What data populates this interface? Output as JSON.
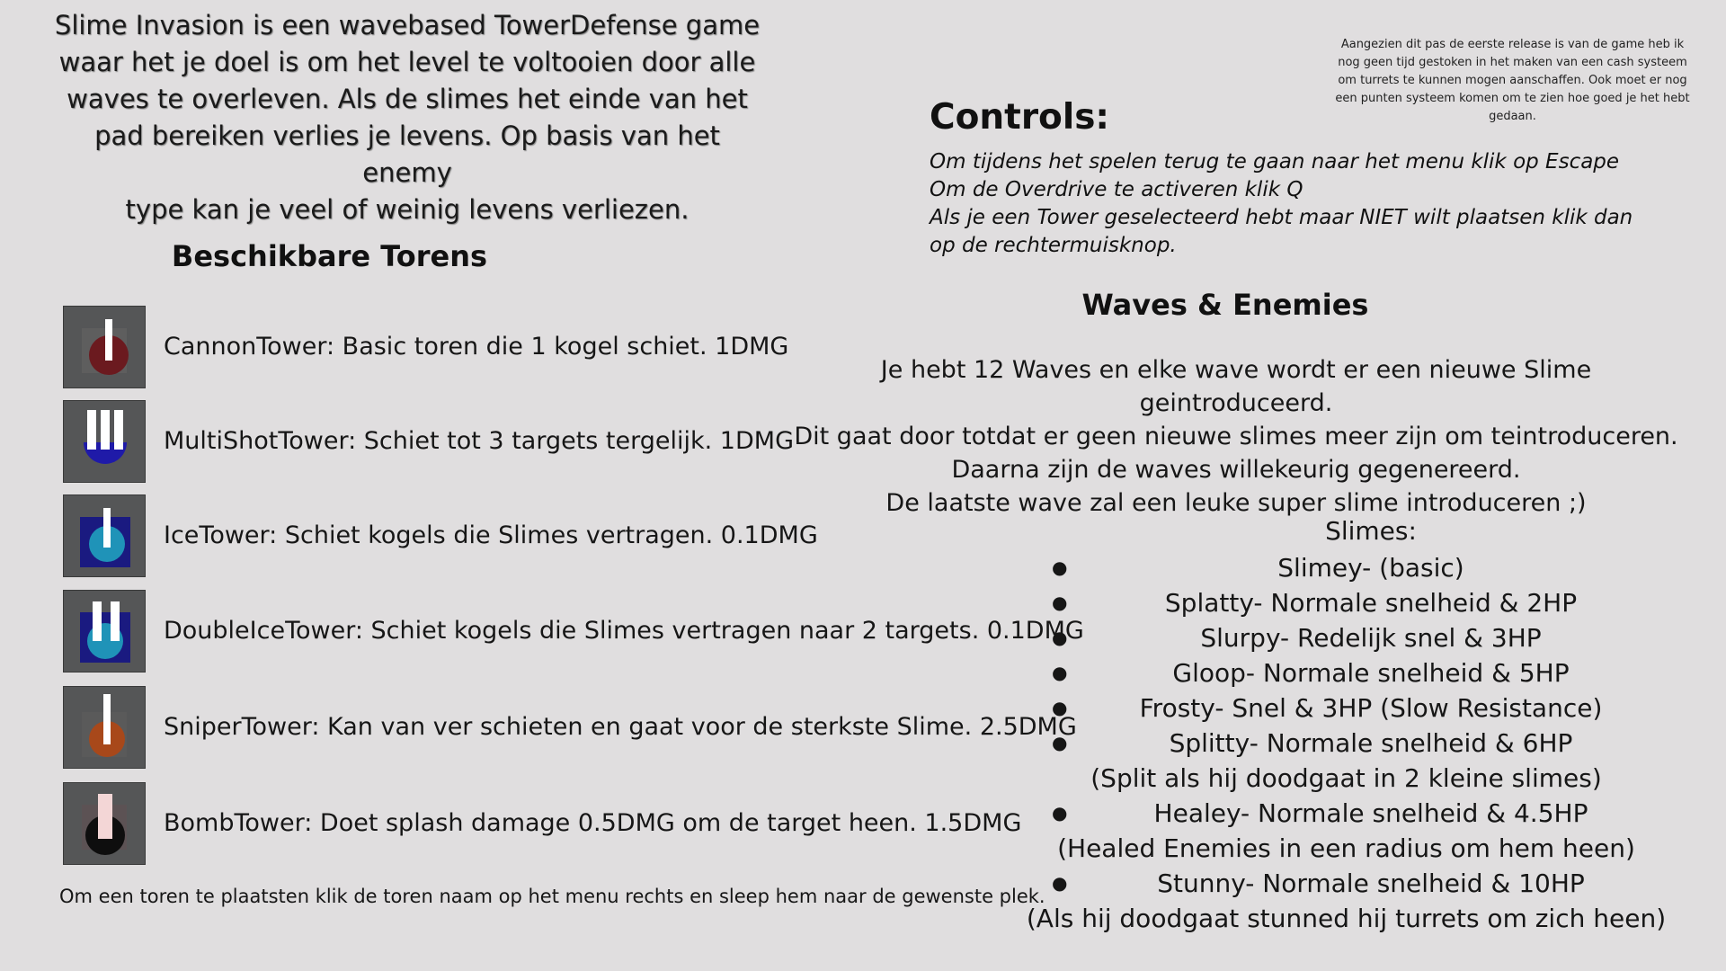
{
  "intro": {
    "lines": [
      "Slime Invasion is een wavebased TowerDefense game",
      "waar het je doel is om het level te voltooien door alle",
      "waves te overleven. Als de slimes het einde van het",
      "pad bereiken verlies je levens. Op basis van het enemy",
      "type kan je veel of weinig levens verliezen."
    ]
  },
  "note": "Aangezien dit pas de eerste release is van de game heb ik nog geen tijd gestoken in het maken van een cash systeem om turrets te kunnen mogen aanschaffen. Ook moet er nog een punten systeem komen om te zien hoe goed je het hebt gedaan.",
  "controls": {
    "title": "Controls:",
    "items": [
      "Om tijdens het spelen terug te gaan naar het menu klik op Escape",
      "Om de Overdrive te activeren klik Q",
      "Als je een Tower geselecteerd hebt maar NIET wilt plaatsen klik dan op de rechtermuisknop."
    ]
  },
  "towers": {
    "title": "Beschikbare Torens",
    "items": [
      {
        "label": "CannonTower: Basic toren die 1 kogel schiet. 1DMG",
        "icon": "cannon-tower-icon",
        "color": "#6b1a1f"
      },
      {
        "label": "MultiShotTower: Schiet tot 3 targets tergelijk. 1DMG",
        "icon": "multishot-tower-icon",
        "color": "#1f1aa8"
      },
      {
        "label": "IceTower: Schiet kogels die Slimes vertragen. 0.1DMG",
        "icon": "ice-tower-icon",
        "color": "#1f93b8"
      },
      {
        "label": "DoubleIceTower: Schiet kogels die Slimes vertragen naar 2 targets. 0.1DMG",
        "icon": "double-ice-tower-icon",
        "color": "#1f93b8"
      },
      {
        "label": "SniperTower: Kan van ver schieten en gaat voor de sterkste Slime. 2.5DMG",
        "icon": "sniper-tower-icon",
        "color": "#a8481a"
      },
      {
        "label": "BombTower: Doet splash damage 0.5DMG om de target heen. 1.5DMG",
        "icon": "bomb-tower-icon",
        "color": "#111111"
      }
    ],
    "hint": "Om een toren te plaatsten klik de toren naam op het menu rechts en sleep hem naar de gewenste plek."
  },
  "waves": {
    "title": "Waves & Enemies",
    "lines": [
      "Je hebt 12 Waves en elke wave wordt er een nieuwe Slime geintroduceerd.",
      "Dit gaat door totdat er geen nieuwe slimes meer zijn om teintroduceren.",
      "Daarna zijn de waves willekeurig gegenereerd.",
      "De laatste wave zal een leuke super slime introduceren ;)"
    ],
    "slimes_heading": "Slimes:",
    "slimes": [
      {
        "name": "Slimey- (basic)",
        "detail": ""
      },
      {
        "name": "Splatty- Normale snelheid & 2HP",
        "detail": ""
      },
      {
        "name": "Slurpy- Redelijk snel  & 3HP",
        "detail": ""
      },
      {
        "name": "Gloop- Normale snelheid & 5HP",
        "detail": ""
      },
      {
        "name": "Frosty- Snel & 3HP (Slow Resistance)",
        "detail": ""
      },
      {
        "name": "Splitty- Normale snelheid & 6HP",
        "detail": "(Split als hij doodgaat in 2 kleine slimes)"
      },
      {
        "name": "Healey- Normale snelheid & 4.5HP",
        "detail": "(Healed Enemies in een radius om hem heen)"
      },
      {
        "name": "Stunny- Normale snelheid & 10HP",
        "detail": "(Als hij doodgaat stunned hij turrets om zich heen)"
      }
    ]
  }
}
